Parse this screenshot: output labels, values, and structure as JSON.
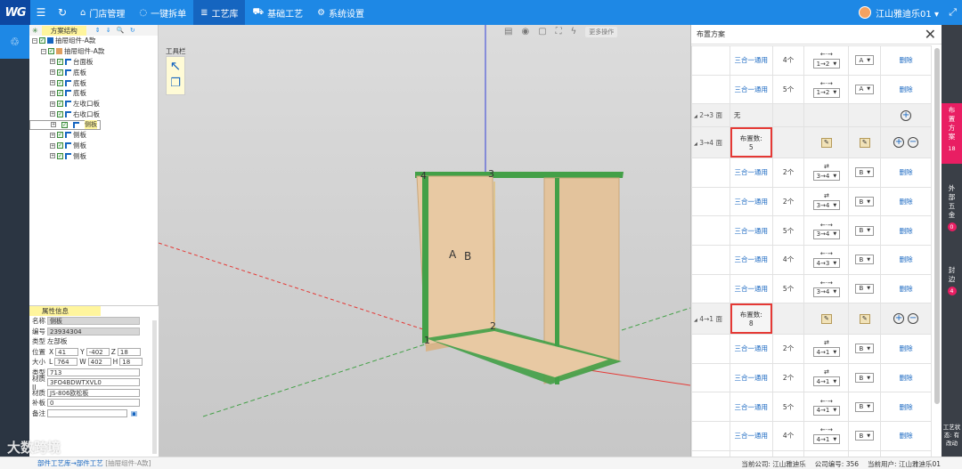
{
  "topbar": {
    "logo": "WG",
    "nav": [
      {
        "icon": "home-icon",
        "label": "门店管理"
      },
      {
        "icon": "check-circle-icon",
        "label": "一键拆单"
      },
      {
        "icon": "layers-icon",
        "label": "工艺库"
      },
      {
        "icon": "car-icon",
        "label": "基础工艺"
      },
      {
        "icon": "gear-icon",
        "label": "系统设置"
      }
    ],
    "user": "江山雅迪乐01 ▾"
  },
  "tree": {
    "title": "方案结构",
    "tools": "⇕ ⇓ 🔍 ↻",
    "root": "抽屉组件-A款",
    "child": "抽屉组件-A款",
    "leaves": [
      "台面板",
      "底板",
      "底板",
      "底板",
      "左收口板",
      "右收口板",
      "侧板",
      "侧板",
      "侧板",
      "侧板"
    ]
  },
  "props": {
    "title": "属性信息",
    "name_label": "名称",
    "name": "侧板",
    "code_label": "编号",
    "code": "23934304",
    "type_label": "类型",
    "type": "左部板",
    "pos_label": "位置",
    "pos_x": "41",
    "pos_y": "-402",
    "pos_z": "18",
    "size_label": "大小",
    "size_l": "764",
    "size_w": "402",
    "size_h": "18",
    "kind_label": "类型",
    "kind": "713",
    "mat1_label": "材质II",
    "mat1": "3FO4BDWTXVL0",
    "mat2_label": "材质",
    "mat2": "JS-806欧松板",
    "patch_label": "补板",
    "patch": "0",
    "remark_label": "备注",
    "remark": ""
  },
  "viewport": {
    "tool_label": "工具栏",
    "more_ops": "更多操作",
    "labels": {
      "a": "A",
      "b": "B",
      "p1": "1",
      "p2": "2",
      "p3": "3",
      "p4": "4"
    }
  },
  "panel": {
    "title": "布置方案",
    "rows": [
      {
        "type": "row",
        "name": "三合一通用",
        "count": "4个",
        "arrow": "←·→",
        "pattern": "1→2",
        "opt": "A",
        "action": "删除"
      },
      {
        "type": "row",
        "name": "三合一通用",
        "count": "5个",
        "arrow": "←·→",
        "pattern": "1→2",
        "opt": "A",
        "action": "删除"
      },
      {
        "type": "section",
        "label": "2→3 面",
        "text": "无"
      },
      {
        "type": "section",
        "label": "3→4 面",
        "text": "布置数: 5",
        "highlight": true
      },
      {
        "type": "row",
        "name": "三合一通用",
        "count": "2个",
        "arrow": "⇄",
        "pattern": "3→4",
        "opt": "B",
        "action": "删除"
      },
      {
        "type": "row",
        "name": "三合一通用",
        "count": "2个",
        "arrow": "⇄",
        "pattern": "3→4",
        "opt": "B",
        "action": "删除"
      },
      {
        "type": "row",
        "name": "三合一通用",
        "count": "5个",
        "arrow": "←·→",
        "pattern": "3→4",
        "opt": "B",
        "action": "删除"
      },
      {
        "type": "row",
        "name": "三合一通用",
        "count": "4个",
        "arrow": "←·→",
        "pattern": "4→3",
        "opt": "B",
        "action": "删除"
      },
      {
        "type": "row",
        "name": "三合一通用",
        "count": "5个",
        "arrow": "←·→",
        "pattern": "3→4",
        "opt": "B",
        "action": "删除"
      },
      {
        "type": "section",
        "label": "4→1 面",
        "text": "布置数: 8",
        "highlight": true
      },
      {
        "type": "row",
        "name": "三合一通用",
        "count": "2个",
        "arrow": "⇄",
        "pattern": "4→1",
        "opt": "B",
        "action": "删除"
      },
      {
        "type": "row",
        "name": "三合一通用",
        "count": "2个",
        "arrow": "⇄",
        "pattern": "4→1",
        "opt": "B",
        "action": "删除"
      },
      {
        "type": "row",
        "name": "三合一通用",
        "count": "5个",
        "arrow": "←·→",
        "pattern": "4→1",
        "opt": "B",
        "action": "删除"
      },
      {
        "type": "row",
        "name": "三合一通用",
        "count": "4个",
        "arrow": "←·→",
        "pattern": "4→1",
        "opt": "B",
        "action": "删除"
      },
      {
        "type": "row",
        "name": "三合一通用",
        "count": "5个",
        "arrow": "←·→",
        "pattern": "4→1",
        "opt": "B",
        "action": "删除"
      }
    ]
  },
  "rightside": [
    {
      "label": "布置方案",
      "badge": "18",
      "active": true
    },
    {
      "label": "外部五金",
      "badge": "0",
      "active": false
    },
    {
      "label": "封边",
      "badge": "4",
      "active": false
    },
    {
      "label": "工艺状态: 有改动",
      "badge": "",
      "active": false
    }
  ],
  "status": {
    "crumb1": "部件工艺库",
    "crumb2": "部件工艺",
    "crumb3": "[抽屉组件-A款]",
    "company": "当前公司: 江山雅迪乐",
    "company_no": "公司编号: 356",
    "current_user": "当前用户: 江山雅迪乐01"
  },
  "watermark": "大数跨境",
  "colors": {
    "topbar": "#1e88e5",
    "accent_pink": "#e91e63",
    "board": "#e8c9a3",
    "edge": "#43a047",
    "highlight_box": "#e53935"
  }
}
